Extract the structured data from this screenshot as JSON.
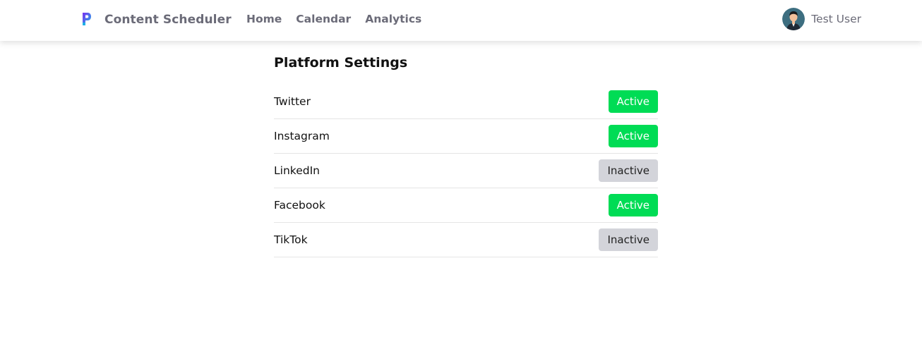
{
  "navbar": {
    "brand_name": "Content Scheduler",
    "logo_icon": "brand-p-logo-icon",
    "links": [
      {
        "label": "Home"
      },
      {
        "label": "Calendar"
      },
      {
        "label": "Analytics"
      }
    ],
    "user": {
      "name": "Test User",
      "avatar_icon": "user-avatar-icon"
    }
  },
  "main": {
    "title": "Platform Settings",
    "platforms": [
      {
        "name": "Twitter",
        "status": "Active"
      },
      {
        "name": "Instagram",
        "status": "Active"
      },
      {
        "name": "LinkedIn",
        "status": "Inactive"
      },
      {
        "name": "Facebook",
        "status": "Active"
      },
      {
        "name": "TikTok",
        "status": "Inactive"
      }
    ]
  },
  "colors": {
    "active": "#00dc55",
    "inactive": "#d3d4da",
    "nav_text": "#6b6b78"
  }
}
